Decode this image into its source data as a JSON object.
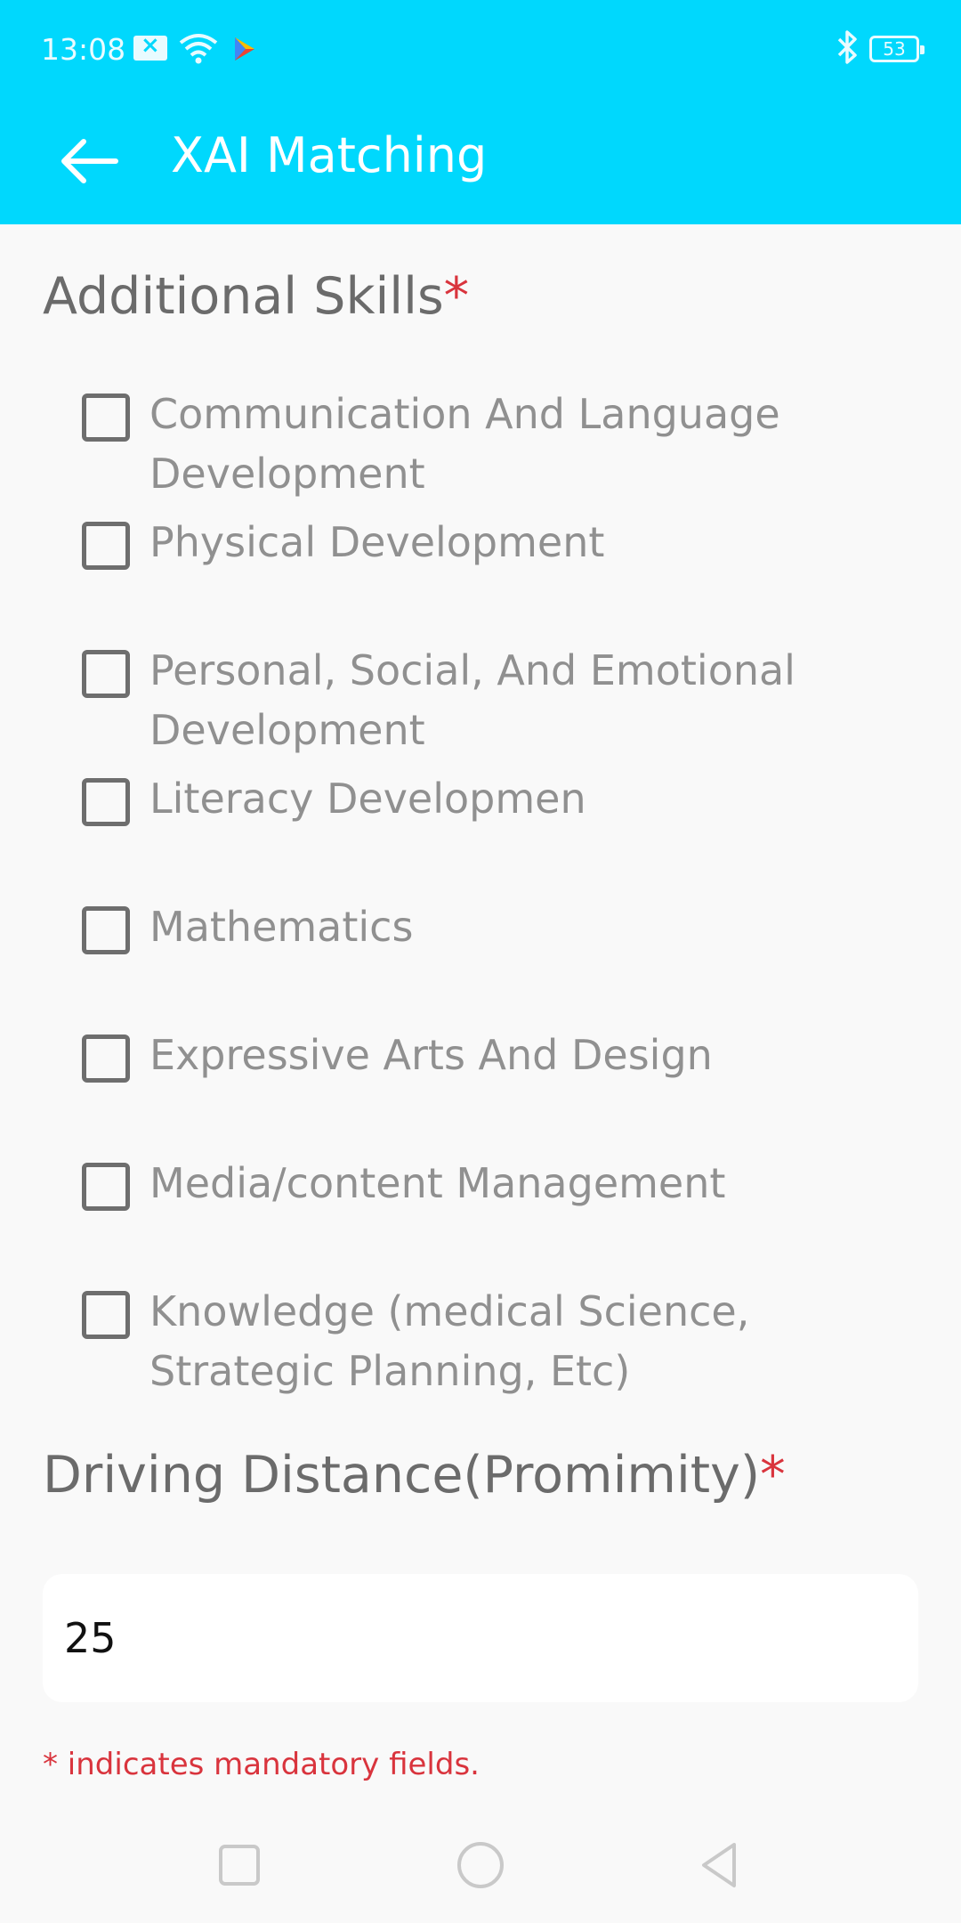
{
  "status_bar": {
    "time": "13:08",
    "battery": "53",
    "icons": [
      "message-icon",
      "wifi-icon",
      "play-store-icon",
      "bluetooth-icon",
      "battery-icon"
    ]
  },
  "app_bar": {
    "title": "XAI Matching",
    "back_icon": "arrow-left-icon",
    "color": "#00d8fd"
  },
  "additional_skills": {
    "title": "Additional Skills",
    "required_mark": "*",
    "items": [
      {
        "label": "Communication And Language Development",
        "checked": false
      },
      {
        "label": "Physical Development",
        "checked": false
      },
      {
        "label": "Personal, Social, And Emotional Development",
        "checked": false
      },
      {
        "label": "Literacy Developmen",
        "checked": false
      },
      {
        "label": "Mathematics",
        "checked": false
      },
      {
        "label": "Expressive Arts And Design",
        "checked": false
      },
      {
        "label": "Media/content Management",
        "checked": false
      },
      {
        "label": "Knowledge (medical Science, Strategic Planning, Etc)",
        "checked": false
      }
    ]
  },
  "driving_distance": {
    "title": "Driving Distance(Promimity)",
    "required_mark": "*",
    "value": "25"
  },
  "footer": {
    "note": "* indicates mandatory fields.",
    "note_color": "#d9343d"
  },
  "nav_bar": {
    "icons": [
      "recents-icon",
      "home-icon",
      "back-icon"
    ]
  }
}
